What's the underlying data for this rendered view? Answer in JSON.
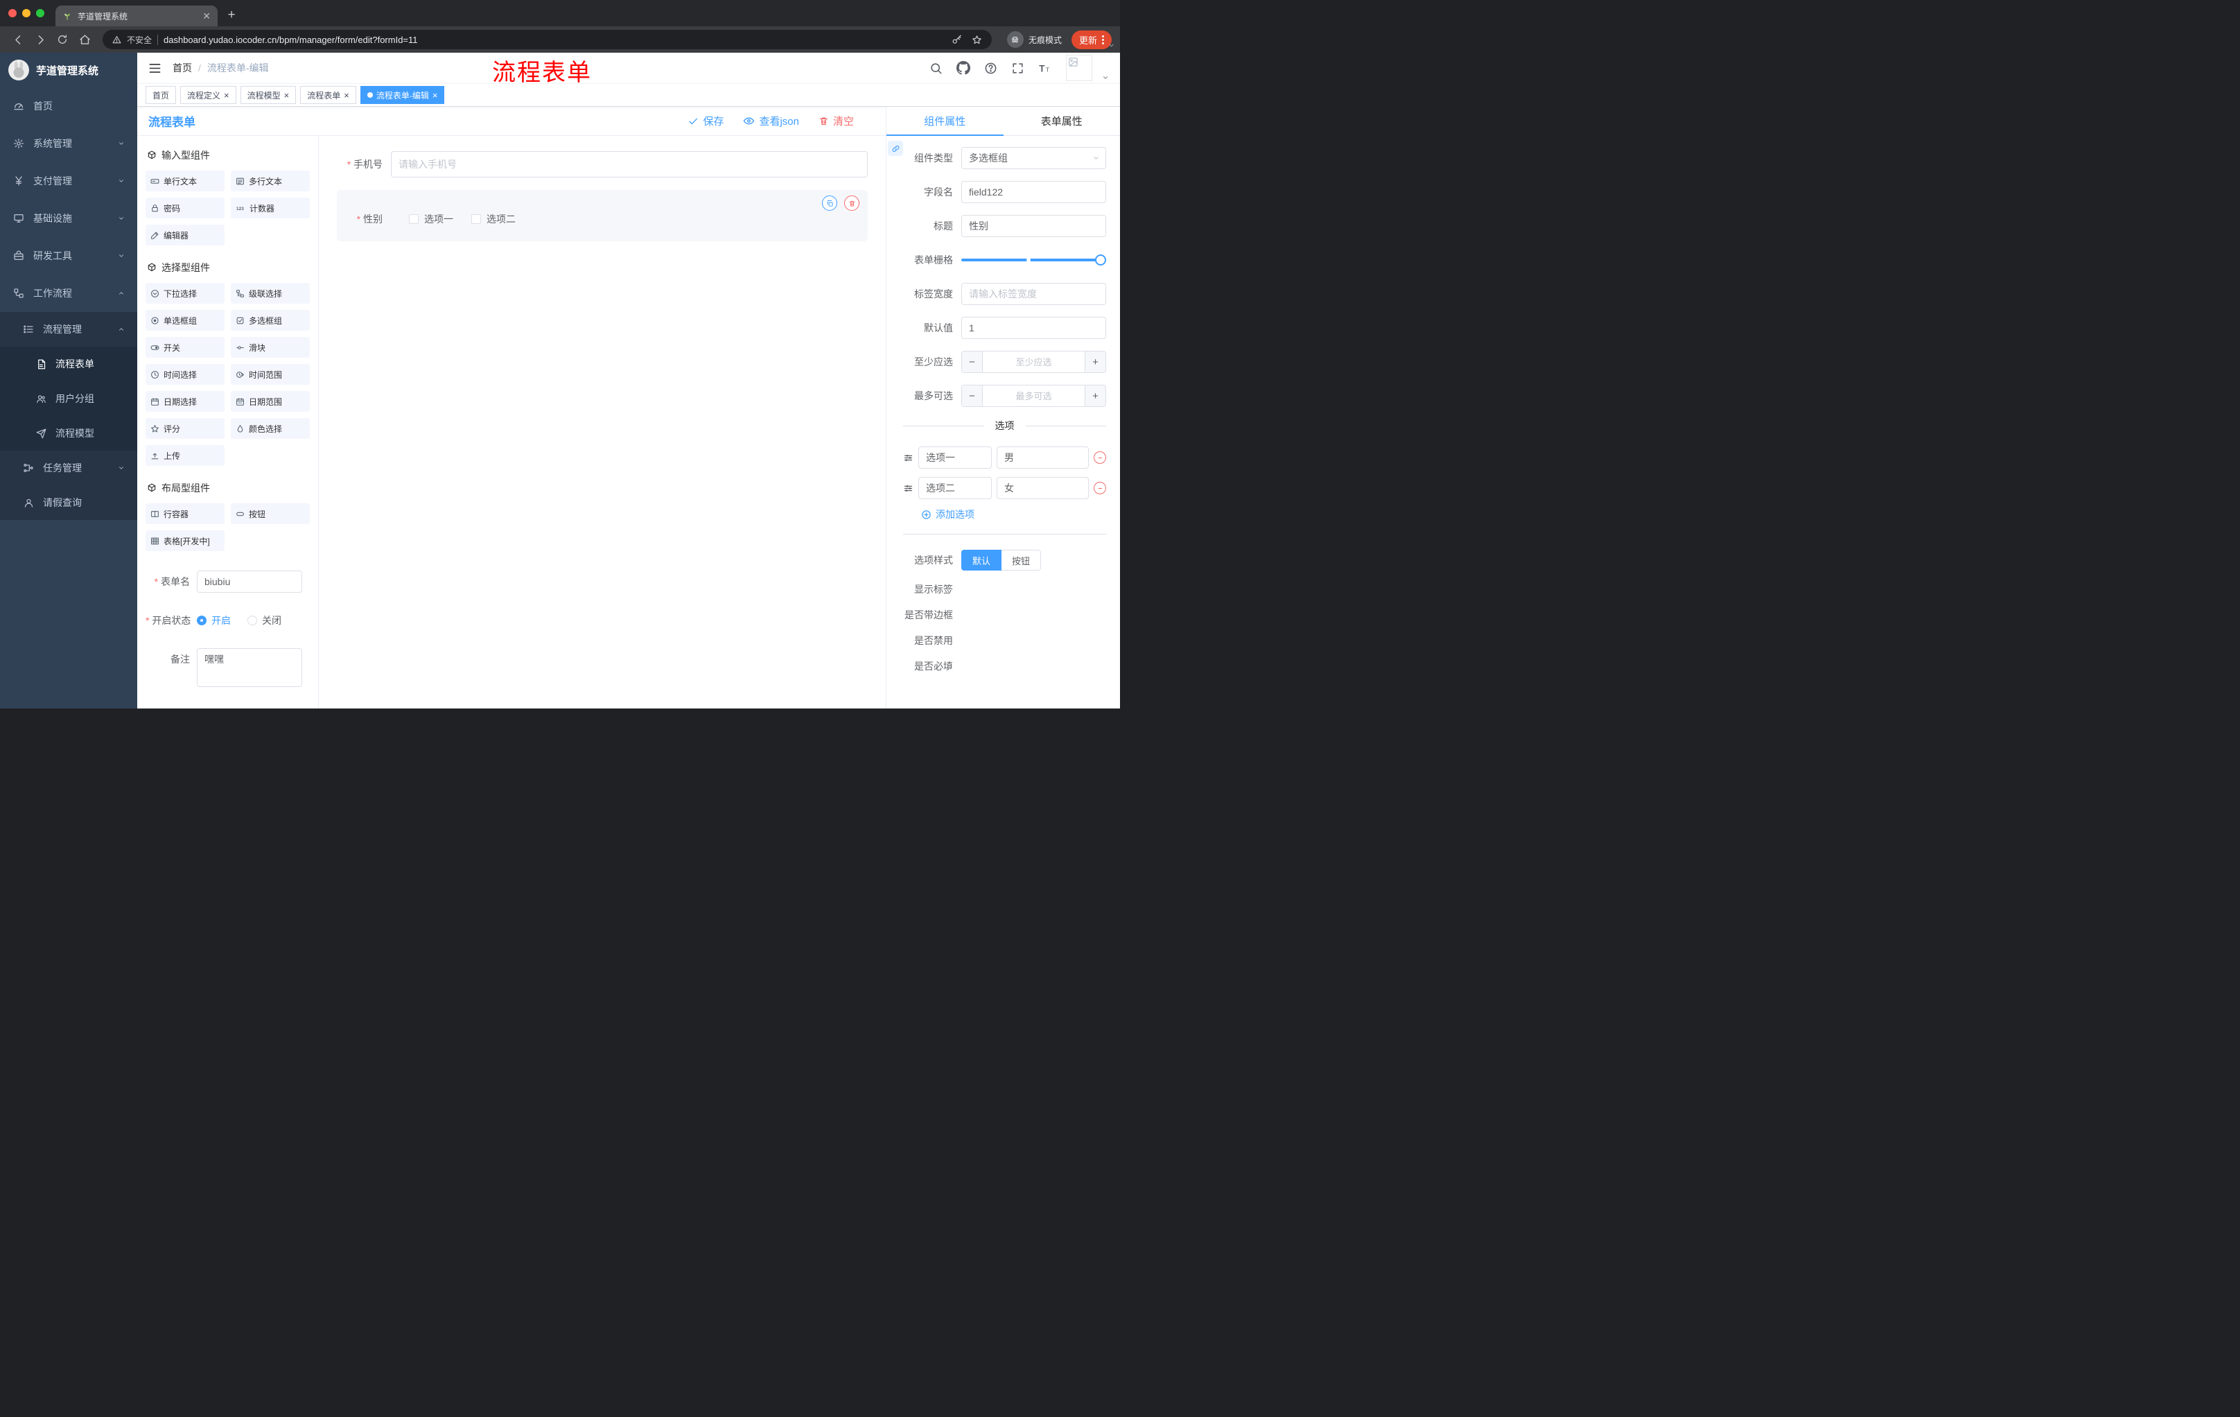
{
  "browser": {
    "tab_title": "芋道管理系统",
    "security_label": "不安全",
    "url": "dashboard.yudao.iocoder.cn/bpm/manager/form/edit?formId=11",
    "incognito_label": "无痕模式",
    "update_label": "更新"
  },
  "sidebar": {
    "logo_title": "芋道管理系统",
    "items": [
      {
        "label": "首页"
      },
      {
        "label": "系统管理"
      },
      {
        "label": "支付管理"
      },
      {
        "label": "基础设施"
      },
      {
        "label": "研发工具"
      },
      {
        "label": "工作流程"
      },
      {
        "label": "流程管理"
      },
      {
        "label": "流程表单"
      },
      {
        "label": "用户分组"
      },
      {
        "label": "流程模型"
      },
      {
        "label": "任务管理"
      },
      {
        "label": "请假查询"
      }
    ]
  },
  "header": {
    "breadcrumb_home": "首页",
    "breadcrumb_current": "流程表单-编辑",
    "annotation": "流程表单"
  },
  "tabs": [
    {
      "label": "首页",
      "closable": false,
      "active": false
    },
    {
      "label": "流程定义",
      "closable": true,
      "active": false
    },
    {
      "label": "流程模型",
      "closable": true,
      "active": false
    },
    {
      "label": "流程表单",
      "closable": true,
      "active": false
    },
    {
      "label": "流程表单-编辑",
      "closable": true,
      "active": true
    }
  ],
  "toolbar": {
    "title": "流程表单",
    "save": "保存",
    "view_json": "查看json",
    "clear": "清空"
  },
  "palette": {
    "groups": [
      {
        "title": "输入型组件",
        "items": [
          "单行文本",
          "多行文本",
          "密码",
          "计数器",
          "编辑器"
        ]
      },
      {
        "title": "选择型组件",
        "items": [
          "下拉选择",
          "级联选择",
          "单选框组",
          "多选框组",
          "开关",
          "滑块",
          "时间选择",
          "时间范围",
          "日期选择",
          "日期范围",
          "评分",
          "颜色选择",
          "上传"
        ]
      },
      {
        "title": "布局型组件",
        "items": [
          "行容器",
          "按钮",
          "表格[开发中]"
        ]
      }
    ]
  },
  "form_meta": {
    "name_label": "表单名",
    "name_value": "biubiu",
    "status_label": "开启状态",
    "status_on": "开启",
    "status_off": "关闭",
    "remark_label": "备注",
    "remark_value": "嘿嘿"
  },
  "canvas": {
    "phone_label": "手机号",
    "phone_placeholder": "请输入手机号",
    "gender_label": "性别",
    "gender_options": [
      {
        "label": "选项一",
        "checked": false
      },
      {
        "label": "选项二",
        "checked": false
      }
    ]
  },
  "inspector": {
    "tab_component": "组件属性",
    "tab_form": "表单属性",
    "rows": {
      "component_type_label": "组件类型",
      "component_type_value": "多选框组",
      "field_name_label": "字段名",
      "field_name_value": "field122",
      "title_label": "标题",
      "title_value": "性别",
      "grid_label": "表单栅格",
      "label_width_label": "标签宽度",
      "label_width_placeholder": "请输入标签宽度",
      "default_label": "默认值",
      "default_value": "1",
      "min_label": "至少应选",
      "min_placeholder": "至少应选",
      "max_label": "最多可选",
      "max_placeholder": "最多可选"
    },
    "options_title": "选项",
    "options": [
      {
        "label": "选项一",
        "value": "男"
      },
      {
        "label": "选项二",
        "value": "女"
      }
    ],
    "add_option": "添加选项",
    "style_label": "选项样式",
    "style_default": "默认",
    "style_button": "按钮",
    "toggle_show_label": "显示标签",
    "toggle_border": "是否带边框",
    "toggle_disabled": "是否禁用",
    "toggle_required": "是否必填",
    "toggle_states": {
      "show_label": true,
      "border": false,
      "disabled": false,
      "required": true
    }
  },
  "colors": {
    "accent": "#409EFF",
    "danger": "#F56C6C",
    "annotation_red": "#FF0000",
    "sidebar_bg": "#304156",
    "update_pill": "#E2492F"
  }
}
